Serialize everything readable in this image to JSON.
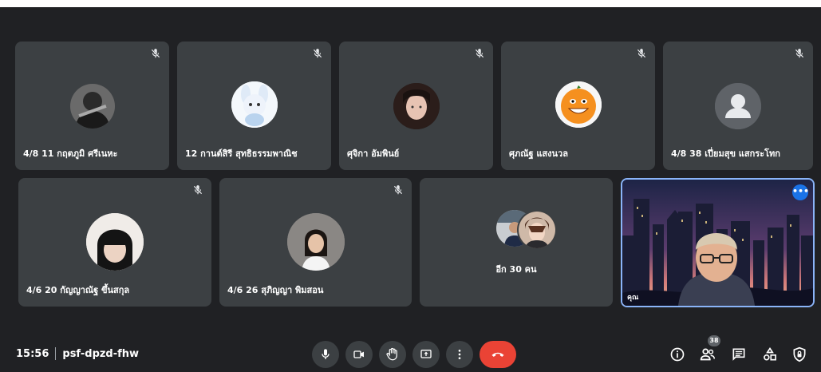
{
  "participants_row1": [
    {
      "name": "4/8 11 กฤตภูมิ ศรีเนหะ"
    },
    {
      "name": "12 กานต์สิรี สุทธิธรรมพาณิช"
    },
    {
      "name": "ศุจิกา อัมพินย์"
    },
    {
      "name": "ศุภณัฐ แสงนวล"
    },
    {
      "name": "4/8 38 เปี่ยมสุข แสกระโทก"
    }
  ],
  "participants_row2": [
    {
      "name": "4/6 20 กัญญาณัฐ ขึ้นสกุล"
    },
    {
      "name": "4/6 26 สุภิญญา พิมสอน"
    }
  ],
  "overflow_tile": {
    "label": "อีก 30 คน"
  },
  "self_tile": {
    "name": "คุณ",
    "more_icon": "more-horiz-icon"
  },
  "meeting": {
    "time": "15:56",
    "code": "psf-dpzd-fhw"
  },
  "controls": [
    "mic-icon",
    "camera-icon",
    "raise-hand-icon",
    "present-screen-icon",
    "more-options-icon",
    "end-call-icon"
  ],
  "right_controls": [
    "info-icon",
    "people-icon",
    "chat-icon",
    "activities-icon",
    "host-controls-icon"
  ],
  "people_count": "38",
  "colors": {
    "background": "#202124",
    "tile": "#3c4043",
    "end_call": "#ea4335",
    "accent": "#1a73e8"
  }
}
